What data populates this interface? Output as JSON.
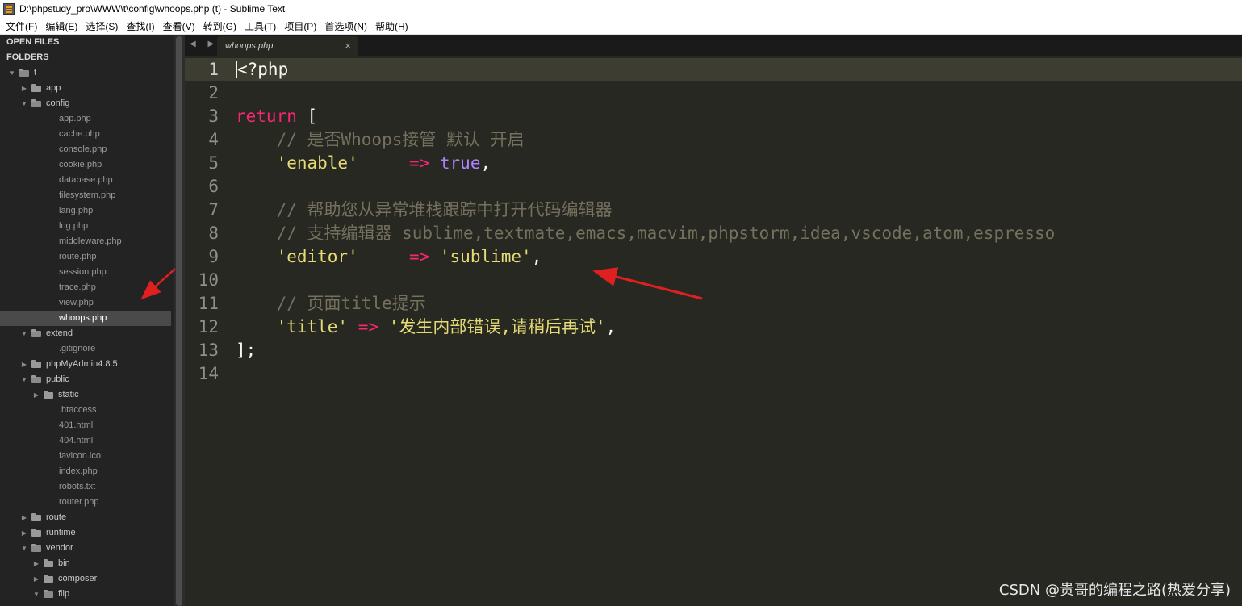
{
  "window": {
    "title": "D:\\phpstudy_pro\\WWW\\t\\config\\whoops.php (t) - Sublime Text"
  },
  "menu": [
    "文件(F)",
    "编辑(E)",
    "选择(S)",
    "查找(I)",
    "查看(V)",
    "转到(G)",
    "工具(T)",
    "项目(P)",
    "首选项(N)",
    "帮助(H)"
  ],
  "sidebar": {
    "open_files_label": "OPEN FILES",
    "folders_label": "FOLDERS",
    "tree": [
      {
        "label": "t",
        "type": "folder",
        "open": true,
        "depth": 0
      },
      {
        "label": "app",
        "type": "folder",
        "open": false,
        "depth": 1
      },
      {
        "label": "config",
        "type": "folder",
        "open": true,
        "depth": 1
      },
      {
        "label": "app.php",
        "type": "file",
        "depth": 2
      },
      {
        "label": "cache.php",
        "type": "file",
        "depth": 2
      },
      {
        "label": "console.php",
        "type": "file",
        "depth": 2
      },
      {
        "label": "cookie.php",
        "type": "file",
        "depth": 2
      },
      {
        "label": "database.php",
        "type": "file",
        "depth": 2
      },
      {
        "label": "filesystem.php",
        "type": "file",
        "depth": 2
      },
      {
        "label": "lang.php",
        "type": "file",
        "depth": 2
      },
      {
        "label": "log.php",
        "type": "file",
        "depth": 2
      },
      {
        "label": "middleware.php",
        "type": "file",
        "depth": 2
      },
      {
        "label": "route.php",
        "type": "file",
        "depth": 2
      },
      {
        "label": "session.php",
        "type": "file",
        "depth": 2
      },
      {
        "label": "trace.php",
        "type": "file",
        "depth": 2
      },
      {
        "label": "view.php",
        "type": "file",
        "depth": 2
      },
      {
        "label": "whoops.php",
        "type": "file",
        "depth": 2,
        "selected": true
      },
      {
        "label": "extend",
        "type": "folder",
        "open": true,
        "depth": 1
      },
      {
        "label": ".gitignore",
        "type": "file",
        "depth": 2
      },
      {
        "label": "phpMyAdmin4.8.5",
        "type": "folder",
        "open": false,
        "depth": 1
      },
      {
        "label": "public",
        "type": "folder",
        "open": true,
        "depth": 1
      },
      {
        "label": "static",
        "type": "folder",
        "open": false,
        "depth": 2
      },
      {
        "label": ".htaccess",
        "type": "file",
        "depth": 2
      },
      {
        "label": "401.html",
        "type": "file",
        "depth": 2
      },
      {
        "label": "404.html",
        "type": "file",
        "depth": 2
      },
      {
        "label": "favicon.ico",
        "type": "file",
        "depth": 2
      },
      {
        "label": "index.php",
        "type": "file",
        "depth": 2
      },
      {
        "label": "robots.txt",
        "type": "file",
        "depth": 2
      },
      {
        "label": "router.php",
        "type": "file",
        "depth": 2
      },
      {
        "label": "route",
        "type": "folder",
        "open": false,
        "depth": 1
      },
      {
        "label": "runtime",
        "type": "folder",
        "open": false,
        "depth": 1
      },
      {
        "label": "vendor",
        "type": "folder",
        "open": true,
        "depth": 1
      },
      {
        "label": "bin",
        "type": "folder",
        "open": false,
        "depth": 2
      },
      {
        "label": "composer",
        "type": "folder",
        "open": false,
        "depth": 2
      },
      {
        "label": "filp",
        "type": "folder",
        "open": true,
        "depth": 2
      }
    ]
  },
  "tab": {
    "label": "whoops.php",
    "close": "×",
    "nav": "◀ ▶"
  },
  "editor": {
    "line_numbers": [
      "1",
      "2",
      "3",
      "4",
      "5",
      "6",
      "7",
      "8",
      "9",
      "10",
      "11",
      "12",
      "13",
      "14"
    ],
    "lines": [
      [
        {
          "t": "pl",
          "v": "<?php"
        }
      ],
      [],
      [
        {
          "t": "kw",
          "v": "return"
        },
        {
          "t": "pl",
          "v": " ["
        }
      ],
      [
        {
          "t": "cmt",
          "v": "    // 是否Whoops接管 默认 开启"
        }
      ],
      [
        {
          "t": "str",
          "v": "    'enable'"
        },
        {
          "t": "pl",
          "v": "     "
        },
        {
          "t": "op",
          "v": "=>"
        },
        {
          "t": "pl",
          "v": " "
        },
        {
          "t": "cst",
          "v": "true"
        },
        {
          "t": "pl",
          "v": ","
        }
      ],
      [],
      [
        {
          "t": "cmt",
          "v": "    // 帮助您从异常堆栈跟踪中打开代码编辑器"
        }
      ],
      [
        {
          "t": "cmt",
          "v": "    // 支持编辑器 sublime,textmate,emacs,macvim,phpstorm,idea,vscode,atom,espresso"
        }
      ],
      [
        {
          "t": "str",
          "v": "    'editor'"
        },
        {
          "t": "pl",
          "v": "     "
        },
        {
          "t": "op",
          "v": "=>"
        },
        {
          "t": "pl",
          "v": " "
        },
        {
          "t": "str",
          "v": "'sublime'"
        },
        {
          "t": "pl",
          "v": ","
        }
      ],
      [],
      [
        {
          "t": "cmt",
          "v": "    // 页面title提示"
        }
      ],
      [
        {
          "t": "str",
          "v": "    'title'"
        },
        {
          "t": "pl",
          "v": " "
        },
        {
          "t": "op",
          "v": "=>"
        },
        {
          "t": "pl",
          "v": " "
        },
        {
          "t": "str",
          "v": "'发生内部错误,请稍后再试'"
        },
        {
          "t": "pl",
          "v": ","
        }
      ],
      [
        {
          "t": "pl",
          "v": "];"
        }
      ],
      []
    ]
  },
  "watermark": "CSDN @贵哥的编程之路(热爱分享)",
  "colors": {
    "annotation_arrow": "#e02020"
  }
}
